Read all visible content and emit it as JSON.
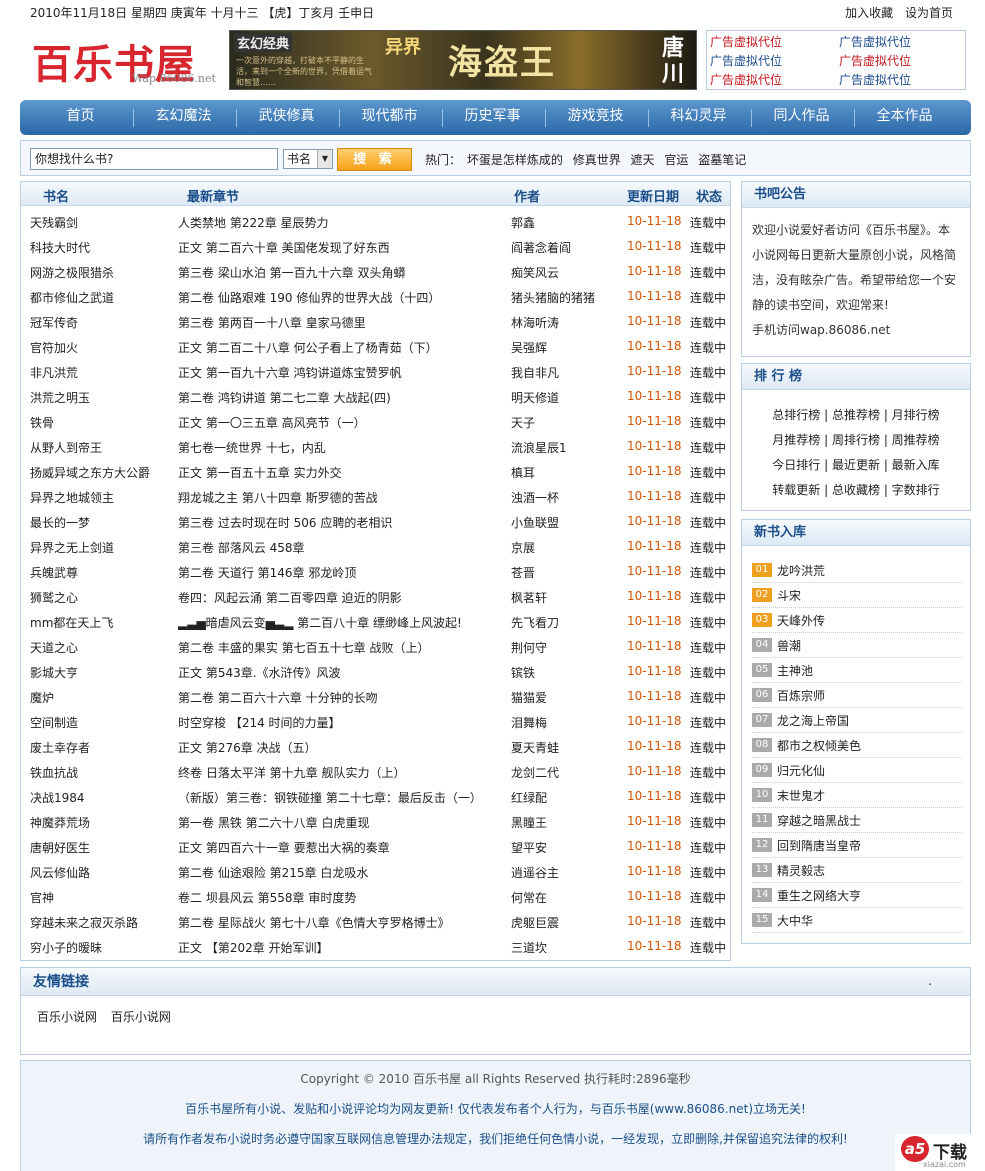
{
  "topbar": {
    "date": "2010年11月18日 星期四 庚寅年 十月十三 【虎】丁亥月 壬申日",
    "add_favorite": "加入收藏",
    "set_home": "设为首页"
  },
  "logo": {
    "cn": "百乐书屋",
    "en": "Wap.86086.net"
  },
  "banner": {
    "tag": "玄幻经典",
    "series": "异界",
    "title": "海盗王",
    "author": "唐川",
    "blurb": "一次意外的穿越，打破本不平静的生活，来到一个全新的世界，凭借着运气和智慧……"
  },
  "ads": [
    "广告虚拟代位",
    "广告虚拟代位",
    "广告虚拟代位",
    "广告虚拟代位",
    "广告虚拟代位",
    "广告虚拟代位"
  ],
  "nav": [
    "首页",
    "玄幻魔法",
    "武侠修真",
    "现代都市",
    "历史军事",
    "游戏竞技",
    "科幻灵异",
    "同人作品",
    "全本作品"
  ],
  "search": {
    "placeholder": "你想找什么书?",
    "select": "书名",
    "button": "搜 索",
    "hot_label": "热门：",
    "hot": [
      "坏蛋是怎样炼成的",
      "修真世界",
      "遮天",
      "官运",
      "盗墓笔记"
    ]
  },
  "list": {
    "headers": [
      "书名",
      "最新章节",
      "作者",
      "更新日期",
      "状态"
    ],
    "rows": [
      [
        "天残霸剑",
        "人类禁地 第222章 星辰势力",
        "郭鑫",
        "10-11-18",
        "连载中"
      ],
      [
        "科技大时代",
        "正文 第二百六十章 美国佬发现了好东西",
        "阎著念着阎",
        "10-11-18",
        "连载中"
      ],
      [
        "网游之极限猎杀",
        "第三卷 梁山水泊 第一百九十六章 双头角蟒",
        "痴笑风云",
        "10-11-18",
        "连载中"
      ],
      [
        "都市修仙之武道",
        "第二卷 仙路艰难 190 修仙界的世界大战（十四）",
        "猪头猪脑的猪猪",
        "10-11-18",
        "连载中"
      ],
      [
        "冠军传奇",
        "第三卷 第两百一十八章 皇家马德里",
        "林海听涛",
        "10-11-18",
        "连载中"
      ],
      [
        "官符加火",
        "正文 第二百二十八章 何公子看上了杨青茹（下）",
        "吴强辉",
        "10-11-18",
        "连载中"
      ],
      [
        "非凡洪荒",
        "正文 第一百九十六章 鸿钧讲道炼宝赞罗帆",
        "我自非凡",
        "10-11-18",
        "连载中"
      ],
      [
        "洪荒之明玉",
        "第二卷 鸿钧讲道 第二七二章 大战起(四)",
        "明天修道",
        "10-11-18",
        "连载中"
      ],
      [
        "铁骨",
        "正文 第一〇三五章 高风亮节（一）",
        "天子",
        "10-11-18",
        "连载中"
      ],
      [
        "从野人到帝王",
        "第七卷一统世界 十七，内乱",
        "流浪星辰1",
        "10-11-18",
        "连载中"
      ],
      [
        "扬威异域之东方大公爵",
        "正文 第一百五十五章 实力外交",
        "槙耳",
        "10-11-18",
        "连载中"
      ],
      [
        "异界之地城领主",
        "翔龙城之主 第八十四章 斯罗德的苦战",
        "浊酒一杯",
        "10-11-18",
        "连载中"
      ],
      [
        "最长的一梦",
        "第三卷 过去时现在时 506 应聘的老相识",
        "小鱼联盟",
        "10-11-18",
        "连载中"
      ],
      [
        "异界之无上剑道",
        "第三卷 部落风云 458章",
        "京展",
        "10-11-18",
        "连载中"
      ],
      [
        "兵魄武尊",
        "第二卷 天道行 第146章 邪龙岭顶",
        "苍晋",
        "10-11-18",
        "连载中"
      ],
      [
        "狮鹫之心",
        "卷四：风起云涌 第二百零四章 迫近的阴影",
        "枫茗轩",
        "10-11-18",
        "连载中"
      ],
      [
        "mm都在天上飞",
        "▂▃▅暗虐风云变▅▃▂ 第二百八十章 缥缈峰上风波起!",
        "先飞看刀",
        "10-11-18",
        "连载中"
      ],
      [
        "天道之心",
        "第二卷 丰盛的果实 第七百五十七章 战败（上）",
        "荆何守",
        "10-11-18",
        "连载中"
      ],
      [
        "影城大亨",
        "正文 第543章.《水浒传》风波",
        "镔铁",
        "10-11-18",
        "连载中"
      ],
      [
        "魔炉",
        "第二卷 第二百六十六章 十分钟的长吻",
        "猫猫爱",
        "10-11-18",
        "连载中"
      ],
      [
        "空间制造",
        "时空穿梭 【214 时间的力量】",
        "泪舞梅",
        "10-11-18",
        "连载中"
      ],
      [
        "废土幸存者",
        "正文 第276章 决战（五）",
        "夏天青蛙",
        "10-11-18",
        "连载中"
      ],
      [
        "铁血抗战",
        "终卷 日落太平洋 第十九章 舰队实力（上）",
        "龙剑二代",
        "10-11-18",
        "连载中"
      ],
      [
        "决战1984",
        "（新版）第三卷：钢铁碰撞 第二十七章：最后反击（一）",
        "红绿配",
        "10-11-18",
        "连载中"
      ],
      [
        "神魔莽荒场",
        "第一卷 黑铁 第二六十八章 白虎重现",
        "黑瞳王",
        "10-11-18",
        "连载中"
      ],
      [
        "唐朝好医生",
        "正文 第四百六十一章 要惹出大祸的奏章",
        "望平安",
        "10-11-18",
        "连载中"
      ],
      [
        "风云修仙路",
        "第二卷 仙途艰险 第215章 白龙吸水",
        "逍遥谷主",
        "10-11-18",
        "连载中"
      ],
      [
        "官神",
        "卷二 坝县风云 第558章 审时度势",
        "何常在",
        "10-11-18",
        "连载中"
      ],
      [
        "穿越未来之寂灭杀路",
        "第二卷 星际战火 第七十八章《色情大亨罗格博士》",
        "虎躯巨震",
        "10-11-18",
        "连载中"
      ],
      [
        "穷小子的暧昧",
        "正文 【第202章 开始军训】",
        "三道坎",
        "10-11-18",
        "连载中"
      ]
    ]
  },
  "notice": {
    "title": "书吧公告",
    "lines": [
      "欢迎小说爱好者访问《百乐书屋》。本",
      "小说网每日更新大量原创小说，风格简",
      "洁，没有眩杂广告。希望带给您一个安",
      "静的读书空间，欢迎常来!",
      "手机访问wap.86086.net"
    ]
  },
  "rank": {
    "title": "排 行 榜",
    "rows": [
      [
        "总排行榜",
        "总推荐榜",
        "月排行榜"
      ],
      [
        "月推荐榜",
        "周排行榜",
        "周推荐榜"
      ],
      [
        "今日排行",
        "最近更新",
        "最新入库"
      ],
      [
        "转载更新",
        "总收藏榜",
        "字数排行"
      ]
    ]
  },
  "newbooks": {
    "title": "新书入库",
    "items": [
      {
        "n": "01",
        "t": "龙吟洪荒",
        "c": "#f0a020"
      },
      {
        "n": "02",
        "t": "斗宋",
        "c": "#f0a020"
      },
      {
        "n": "03",
        "t": "天峰外传",
        "c": "#f0a020"
      },
      {
        "n": "04",
        "t": "兽潮",
        "c": "#aaaaaa"
      },
      {
        "n": "05",
        "t": "主神池",
        "c": "#aaaaaa"
      },
      {
        "n": "06",
        "t": "百炼宗师",
        "c": "#aaaaaa"
      },
      {
        "n": "07",
        "t": "龙之海上帝国",
        "c": "#aaaaaa"
      },
      {
        "n": "08",
        "t": "都市之权倾美色",
        "c": "#aaaaaa"
      },
      {
        "n": "09",
        "t": "归元化仙",
        "c": "#aaaaaa"
      },
      {
        "n": "10",
        "t": "末世鬼才",
        "c": "#aaaaaa"
      },
      {
        "n": "11",
        "t": "穿越之暗黑战士",
        "c": "#aaaaaa"
      },
      {
        "n": "12",
        "t": "回到隋唐当皇帝",
        "c": "#aaaaaa"
      },
      {
        "n": "13",
        "t": "精灵毅志",
        "c": "#aaaaaa"
      },
      {
        "n": "14",
        "t": "重生之网络大亨",
        "c": "#aaaaaa"
      },
      {
        "n": "15",
        "t": "大中华",
        "c": "#aaaaaa"
      }
    ]
  },
  "friend": {
    "title": "友情链接",
    "dot": ".",
    "links": [
      "百乐小说网",
      "百乐小说网"
    ]
  },
  "footer": {
    "copyright": "Copyright © 2010 百乐书屋  all Rights Reserved 执行耗时:2896毫秒",
    "line2": "百乐书屋所有小说、发贴和小说评论均为网友更新! 仅代表发布者个人行为，与百乐书屋(www.86086.net)立场无关!",
    "line3": "请所有作者发布小说时务必遵守国家互联网信息管理办法规定，我们拒绝任何色情小说，一经发现，立即删除,并保留追究法律的权利!"
  },
  "watermark": {
    "a5": "a5",
    "label": "下载",
    "url": "xiazai.com"
  }
}
